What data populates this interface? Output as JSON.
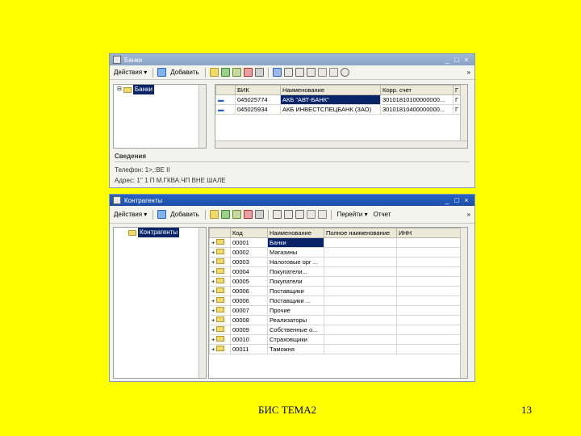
{
  "banks_window": {
    "title": "Банки",
    "controls": [
      "_",
      "□",
      "×"
    ],
    "toolbar": {
      "actions_label": "Действия ▾",
      "add_label": "Добавить",
      "more": "»"
    },
    "tree_root": "Банки",
    "table": {
      "columns": [
        "БИК",
        "Наименование",
        "Корр. счет",
        "Г"
      ],
      "rows": [
        {
          "bik": "045025774",
          "name": "АКБ \"АВТ-БАНК\"",
          "account": "30101810100000000...",
          "g": "Г"
        },
        {
          "bik": "045025934",
          "name": "АКБ ИНВЕСТСПЕЦБАНК (ЗАО)",
          "account": "30101810400000000...",
          "g": "Г"
        }
      ]
    },
    "info_title": "Сведения",
    "info_phone": "Телефон: 1>,:ВЕ II",
    "info_address": "Адрес: 1'' 1 П М.ГКВА.ЧП ВНЕ ШАЛЕ"
  },
  "contractors_window": {
    "title": "Контрагенты",
    "controls": [
      "_",
      "□",
      "×"
    ],
    "toolbar": {
      "actions_label": "Действия ▾",
      "add_label": "Добавить",
      "goto_label": "Перейти ▾",
      "report_label": "Отчет",
      "more": "»"
    },
    "tree_root": "Контрагенты",
    "table": {
      "columns": [
        "Код",
        "Наименование",
        "Полное наименование",
        "ИНН"
      ],
      "rows": [
        {
          "code": "00001",
          "name": "Банки"
        },
        {
          "code": "00002",
          "name": "Магазины"
        },
        {
          "code": "00003",
          "name": "Налоговые орг ..."
        },
        {
          "code": "00004",
          "name": "Покупатели..."
        },
        {
          "code": "00005",
          "name": "Покупатели"
        },
        {
          "code": "00006",
          "name": "Поставщики"
        },
        {
          "code": "00006",
          "name": "Поставщики ..."
        },
        {
          "code": "00007",
          "name": "Прочие"
        },
        {
          "code": "00008",
          "name": "Реализаторы"
        },
        {
          "code": "00009",
          "name": "Собственные о..."
        },
        {
          "code": "00010",
          "name": "Страховщики"
        },
        {
          "code": "00011",
          "name": "Таможня"
        }
      ]
    }
  },
  "footer": {
    "caption": "БИС ТЕМА2",
    "page": "13"
  }
}
